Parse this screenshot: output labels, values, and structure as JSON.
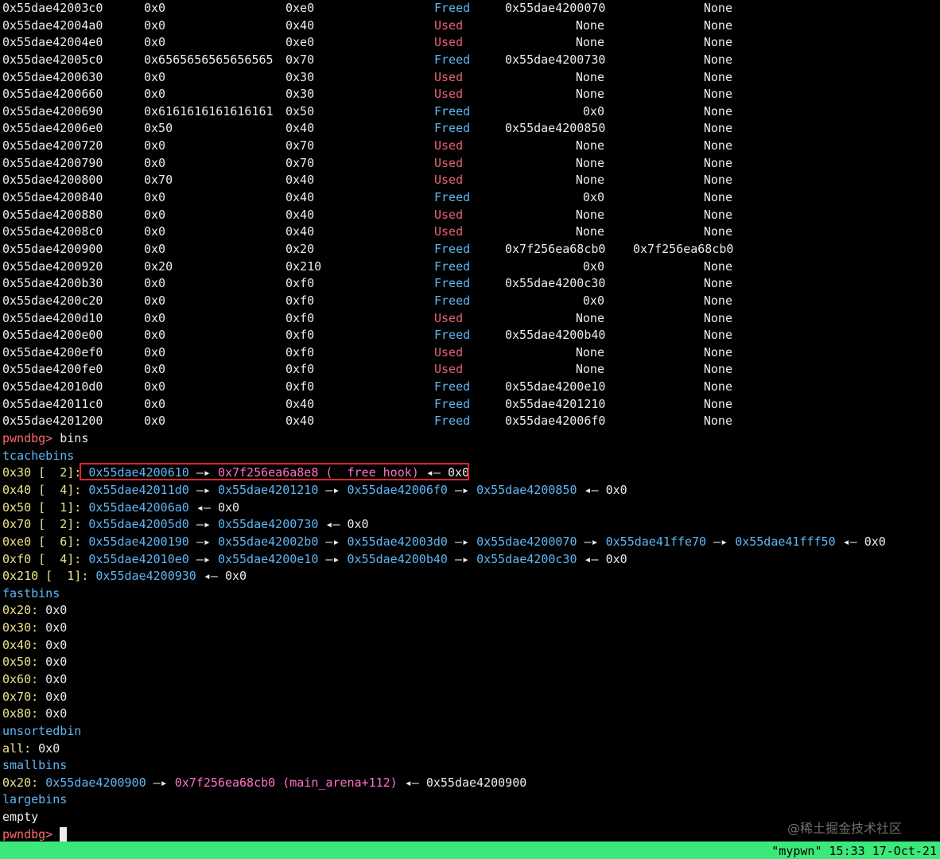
{
  "colors": {
    "background": "#000000",
    "freed": "#5fb6f5",
    "used": "#e8617a",
    "prompt": "#ff6b6b",
    "section": "#5fb6f5",
    "size_label": "#e9e58a",
    "address": "#5fb6f5",
    "libc_address": "#ff70c8",
    "highlight_box": "#e0242a",
    "status_bar": "#3ce87a"
  },
  "heap_rows": [
    {
      "addr": "0x55dae42003c0",
      "prev": "0x0",
      "size": "0xe0",
      "status": "Freed",
      "fd": "0x55dae4200070",
      "bk": "None"
    },
    {
      "addr": "0x55dae42004a0",
      "prev": "0x0",
      "size": "0x40",
      "status": "Used",
      "fd": "None",
      "bk": "None"
    },
    {
      "addr": "0x55dae42004e0",
      "prev": "0x0",
      "size": "0xe0",
      "status": "Used",
      "fd": "None",
      "bk": "None"
    },
    {
      "addr": "0x55dae42005c0",
      "prev": "0x6565656565656565",
      "size": "0x70",
      "status": "Freed",
      "fd": "0x55dae4200730",
      "bk": "None"
    },
    {
      "addr": "0x55dae4200630",
      "prev": "0x0",
      "size": "0x30",
      "status": "Used",
      "fd": "None",
      "bk": "None"
    },
    {
      "addr": "0x55dae4200660",
      "prev": "0x0",
      "size": "0x30",
      "status": "Used",
      "fd": "None",
      "bk": "None"
    },
    {
      "addr": "0x55dae4200690",
      "prev": "0x6161616161616161",
      "size": "0x50",
      "status": "Freed",
      "fd": "0x0",
      "bk": "None"
    },
    {
      "addr": "0x55dae42006e0",
      "prev": "0x50",
      "size": "0x40",
      "status": "Freed",
      "fd": "0x55dae4200850",
      "bk": "None"
    },
    {
      "addr": "0x55dae4200720",
      "prev": "0x0",
      "size": "0x70",
      "status": "Used",
      "fd": "None",
      "bk": "None"
    },
    {
      "addr": "0x55dae4200790",
      "prev": "0x0",
      "size": "0x70",
      "status": "Used",
      "fd": "None",
      "bk": "None"
    },
    {
      "addr": "0x55dae4200800",
      "prev": "0x70",
      "size": "0x40",
      "status": "Used",
      "fd": "None",
      "bk": "None"
    },
    {
      "addr": "0x55dae4200840",
      "prev": "0x0",
      "size": "0x40",
      "status": "Freed",
      "fd": "0x0",
      "bk": "None"
    },
    {
      "addr": "0x55dae4200880",
      "prev": "0x0",
      "size": "0x40",
      "status": "Used",
      "fd": "None",
      "bk": "None"
    },
    {
      "addr": "0x55dae42008c0",
      "prev": "0x0",
      "size": "0x40",
      "status": "Used",
      "fd": "None",
      "bk": "None"
    },
    {
      "addr": "0x55dae4200900",
      "prev": "0x0",
      "size": "0x20",
      "status": "Freed",
      "fd": "0x7f256ea68cb0",
      "bk": "0x7f256ea68cb0"
    },
    {
      "addr": "0x55dae4200920",
      "prev": "0x20",
      "size": "0x210",
      "status": "Freed",
      "fd": "0x0",
      "bk": "None"
    },
    {
      "addr": "0x55dae4200b30",
      "prev": "0x0",
      "size": "0xf0",
      "status": "Freed",
      "fd": "0x55dae4200c30",
      "bk": "None"
    },
    {
      "addr": "0x55dae4200c20",
      "prev": "0x0",
      "size": "0xf0",
      "status": "Freed",
      "fd": "0x0",
      "bk": "None"
    },
    {
      "addr": "0x55dae4200d10",
      "prev": "0x0",
      "size": "0xf0",
      "status": "Used",
      "fd": "None",
      "bk": "None"
    },
    {
      "addr": "0x55dae4200e00",
      "prev": "0x0",
      "size": "0xf0",
      "status": "Freed",
      "fd": "0x55dae4200b40",
      "bk": "None"
    },
    {
      "addr": "0x55dae4200ef0",
      "prev": "0x0",
      "size": "0xf0",
      "status": "Used",
      "fd": "None",
      "bk": "None"
    },
    {
      "addr": "0x55dae4200fe0",
      "prev": "0x0",
      "size": "0xf0",
      "status": "Used",
      "fd": "None",
      "bk": "None"
    },
    {
      "addr": "0x55dae42010d0",
      "prev": "0x0",
      "size": "0xf0",
      "status": "Freed",
      "fd": "0x55dae4200e10",
      "bk": "None"
    },
    {
      "addr": "0x55dae42011c0",
      "prev": "0x0",
      "size": "0x40",
      "status": "Freed",
      "fd": "0x55dae4201210",
      "bk": "None"
    },
    {
      "addr": "0x55dae4201200",
      "prev": "0x0",
      "size": "0x40",
      "status": "Freed",
      "fd": "0x55dae42006f0",
      "bk": "None"
    }
  ],
  "prompt": "pwndbg>",
  "command": " bins",
  "arrow": " —▸ ",
  "back_arrow": " ◂— ",
  "null": "0x0",
  "tcache": {
    "title": "tcachebins",
    "rows": [
      {
        "label": "0x30 [  2]:",
        "chain": [
          "0x55dae4200610",
          "0x7f256ea6a8e8 (__free_hook)"
        ],
        "libc_index": 1,
        "end": "0x0"
      },
      {
        "label": "0x40 [  4]:",
        "chain": [
          "0x55dae42011d0",
          "0x55dae4201210",
          "0x55dae42006f0",
          "0x55dae4200850"
        ],
        "libc_index": -1,
        "end": "0x0"
      },
      {
        "label": "0x50 [  1]:",
        "chain": [
          "0x55dae42006a0"
        ],
        "libc_index": -1,
        "end": "0x0"
      },
      {
        "label": "0x70 [  2]:",
        "chain": [
          "0x55dae42005d0",
          "0x55dae4200730"
        ],
        "libc_index": -1,
        "end": "0x0"
      },
      {
        "label": "0xe0 [  6]:",
        "chain": [
          "0x55dae4200190",
          "0x55dae42002b0",
          "0x55dae42003d0",
          "0x55dae4200070",
          "0x55dae41ffe70",
          "0x55dae41fff50"
        ],
        "libc_index": -1,
        "end": "0x0"
      },
      {
        "label": "0xf0 [  4]:",
        "chain": [
          "0x55dae42010e0",
          "0x55dae4200e10",
          "0x55dae4200b40",
          "0x55dae4200c30"
        ],
        "libc_index": -1,
        "end": "0x0"
      },
      {
        "label": "0x210 [  1]:",
        "chain": [
          "0x55dae4200930"
        ],
        "libc_index": -1,
        "end": "0x0"
      }
    ]
  },
  "fastbins": {
    "title": "fastbins",
    "rows": [
      {
        "label": "0x20:",
        "value": " 0x0"
      },
      {
        "label": "0x30:",
        "value": " 0x0"
      },
      {
        "label": "0x40:",
        "value": " 0x0"
      },
      {
        "label": "0x50:",
        "value": " 0x0"
      },
      {
        "label": "0x60:",
        "value": " 0x0"
      },
      {
        "label": "0x70:",
        "value": " 0x0"
      },
      {
        "label": "0x80:",
        "value": " 0x0"
      }
    ]
  },
  "unsortedbin": {
    "title": "unsortedbin",
    "label": "all:",
    "value": " 0x0"
  },
  "smallbins": {
    "title": "smallbins",
    "label": "0x20:",
    "addr1": "0x55dae4200900",
    "libc": "0x7f256ea68cb0 (main_arena+112)",
    "end": "0x55dae4200900"
  },
  "largebins": {
    "title": "largebins",
    "value": "empty"
  },
  "status_bar": "\"mypwn\" 15:33 17-Oct-21",
  "watermark": "@稀土掘金技术社区"
}
